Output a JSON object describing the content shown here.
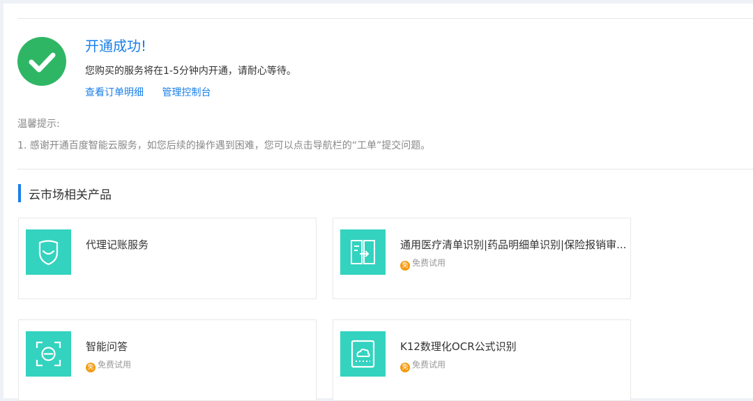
{
  "success": {
    "title": "开通成功!",
    "description": "您购买的服务将在1-5分钟内开通，请耐心等待。",
    "links": [
      "查看订单明细",
      "管理控制台"
    ],
    "icon": "check-circle-icon",
    "color": "#2fb665"
  },
  "tips": {
    "title": "温馨提示:",
    "items": [
      "1. 感谢开通百度智能云服务，如您后续的操作遇到困难，您可以点击导航栏的“工单”提交问题。"
    ]
  },
  "related": {
    "title": "云市场相关产品",
    "accent_color": "#1a7fe8",
    "products": [
      {
        "name": "代理记账服务",
        "badge": "",
        "icon": "smile-shield-icon"
      },
      {
        "name": "通用医疗清单识别|药品明细单识别|保险报销审...",
        "badge": "免费试用",
        "icon": "document-scan-icon"
      },
      {
        "name": "智能问答",
        "badge": "免费试用",
        "icon": "scan-face-icon"
      },
      {
        "name": "K12数理化OCR公式识别",
        "badge": "免费试用",
        "icon": "cloud-box-icon"
      }
    ],
    "badge_mark": "免",
    "thumb_color": "#33d3bf"
  }
}
